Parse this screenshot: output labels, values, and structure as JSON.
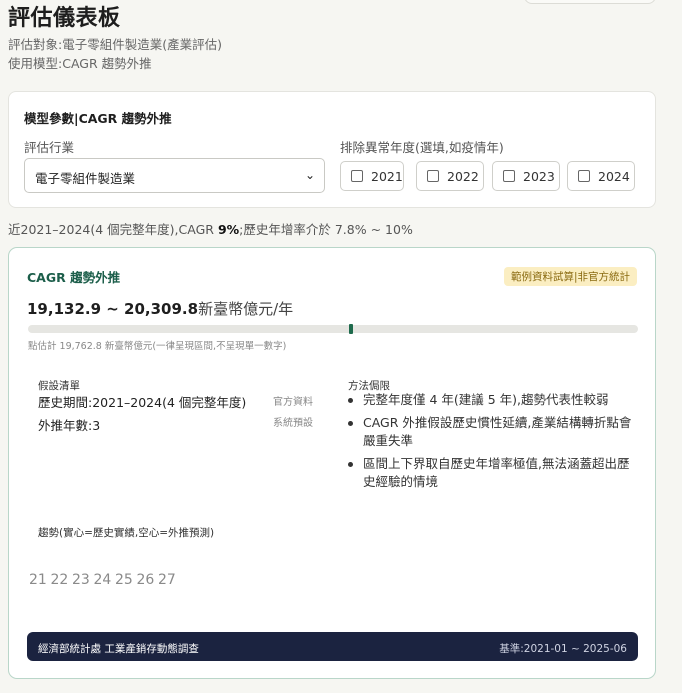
{
  "header": {
    "title": "評估儀表板",
    "target": "評估對象:電子零組件製造業(產業評估)",
    "model": "使用模型:CAGR 趨勢外推"
  },
  "params": {
    "title": "模型參數|CAGR 趨勢外推",
    "industry_label": "評估行業",
    "industry_value": "電子零組件製造業",
    "exclude_label": "排除異常年度(選填,如疫情年)",
    "years": [
      {
        "label": "2021",
        "checked": false
      },
      {
        "label": "2022",
        "checked": false
      },
      {
        "label": "2023",
        "checked": false
      },
      {
        "label": "2024",
        "checked": false
      }
    ]
  },
  "summary": {
    "prefix": "近2021–2024(4 個完整年度),CAGR ",
    "cagr": "9%",
    "suffix": ";歷史年增率介於 7.8% ~ 10%"
  },
  "result": {
    "title": "CAGR 趨勢外推",
    "badge": "範例資料試算|非官方統計",
    "range_low": "19,132.9",
    "range_sep": " ~ ",
    "range_high": "20,309.8",
    "unit": "新臺幣億元/年",
    "estimate_note": "點估計 19,762.8 新臺幣億元(一律呈現區間,不呈現單一數字)",
    "estimate_position": 0.53,
    "assumptions_title": "假設清單",
    "assumptions": [
      {
        "text": "歷史期間:2021–2024(4 個完整年度)",
        "source": "官方資料"
      },
      {
        "text": "外推年數:3",
        "source": "系統預設"
      }
    ],
    "limits_title": "方法侷限",
    "limits": [
      "完整年度僅 4 年(建議 5 年),趨勢代表性較弱",
      "CAGR 外推假設歷史慣性延續,產業結構轉折點會嚴重失準",
      "區間上下界取自歷史年增率極值,無法涵蓋超出歷史經驗的情境"
    ],
    "trend_title": "趨勢(實心=歷史實績,空心=外推預測)",
    "footer_source": "經濟部統計處 工業產銷存動態調查",
    "footer_period": "基準:2021-01 ~ 2025-06"
  },
  "chart_data": {
    "type": "scatter",
    "title": "趨勢(實心=歷史實績,空心=外推預測)",
    "categories": [
      "21",
      "22",
      "23",
      "24",
      "25",
      "26",
      "27"
    ],
    "colors": {
      "tick": "#8a8a8a"
    }
  }
}
